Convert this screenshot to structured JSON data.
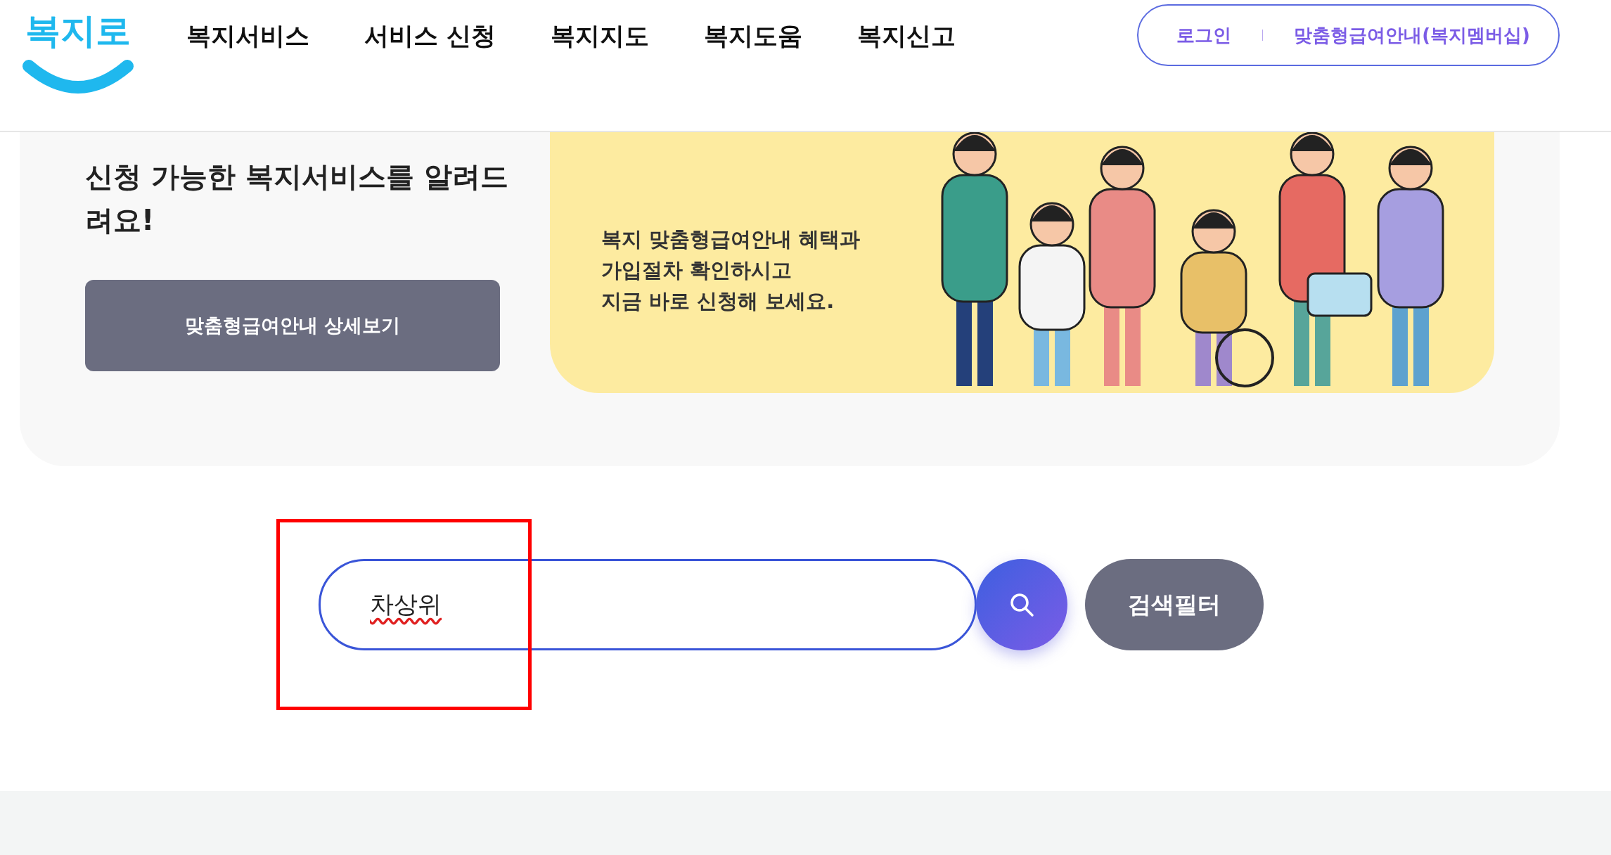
{
  "header": {
    "logo": "복지로",
    "nav": [
      {
        "label": "복지서비스"
      },
      {
        "label": "서비스 신청"
      },
      {
        "label": "복지지도"
      },
      {
        "label": "복지도움"
      },
      {
        "label": "복지신고"
      }
    ],
    "links": [
      {
        "label": "로그인"
      },
      {
        "label": "맞춤형급여안내(복지멤버십)"
      }
    ]
  },
  "hero": {
    "lines": [
      "신청 가능한 복지서비스를 알려드",
      "려요!"
    ],
    "button": "맞춤형급여안내 상세보기"
  },
  "banner": {
    "lines": [
      "복지 맞춤형급여안내 혜택과",
      "가입절차 확인하시고",
      "지금 바로 신청해 보세요."
    ]
  },
  "search": {
    "value": "차상위",
    "misspelled": true,
    "highlighted": true,
    "filter_button": "검색필터"
  }
}
